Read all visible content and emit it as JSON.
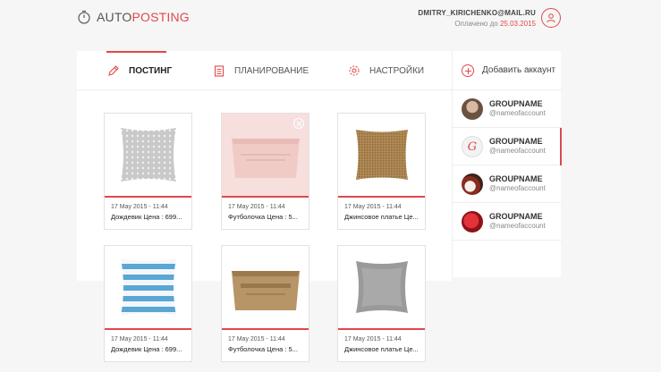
{
  "header": {
    "logo_plain": "AUTO",
    "logo_accent": "POSTING",
    "user_email": "DMITRY_KIRICHENKO@MAIL.RU",
    "paid_label": "Оплачено до",
    "paid_date": "25.03.2015"
  },
  "tabs": [
    {
      "label": "ПОСТИНГ",
      "icon": "pencil-icon",
      "active": true
    },
    {
      "label": "ПЛАНИРОВАНИЕ",
      "icon": "calendar-icon",
      "active": false
    },
    {
      "label": "НАСТРОЙКИ",
      "icon": "gear-icon",
      "active": false
    }
  ],
  "sidebar": {
    "add_label": "Добавить аккаунт",
    "accounts": [
      {
        "name": "GROUPNAME",
        "handle": "@nameofaccount",
        "selected": false
      },
      {
        "name": "GROUPNAME",
        "handle": "@nameofaccount",
        "selected": true
      },
      {
        "name": "GROUPNAME",
        "handle": "@nameofaccount",
        "selected": false
      },
      {
        "name": "GROUPNAME",
        "handle": "@nameofaccount",
        "selected": false
      }
    ]
  },
  "posts": [
    {
      "date": "17 May 2015 - 11:44",
      "title": "Дождевик Цена : 699...",
      "image": "dotted-pillow"
    },
    {
      "date": "17 May 2015 - 11:44",
      "title": "Футболочка Цена : 5...",
      "image": "pink-box"
    },
    {
      "date": "17 May 2015 - 11:44",
      "title": "Джинсовое платье Це...",
      "image": "jute-pillow"
    },
    {
      "date": "17 May 2015 - 11:44",
      "title": "Дождевик Цена : 699...",
      "image": "striped-pillow"
    },
    {
      "date": "17 May 2015 - 11:44",
      "title": "Футболочка Цена : 5...",
      "image": "wooden-box"
    },
    {
      "date": "17 May 2015 - 11:44",
      "title": "Джинсовое платье Це...",
      "image": "grey-pillow"
    }
  ],
  "colors": {
    "accent": "#e0484b",
    "background": "#f6f6f6"
  }
}
